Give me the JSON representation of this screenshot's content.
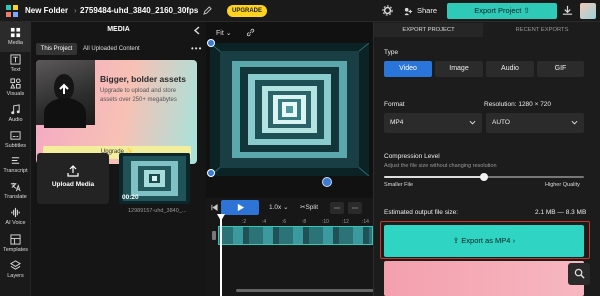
{
  "topbar": {
    "folder": "New Folder",
    "separator": "›",
    "filename": "2759484-uhd_3840_2160_30fps",
    "upgrade": "UPGRADE",
    "share": "Share",
    "export": "Export Project"
  },
  "nav": [
    {
      "label": "Media",
      "icon": "media-icon"
    },
    {
      "label": "Text",
      "icon": "text-icon"
    },
    {
      "label": "Visuals",
      "icon": "visuals-icon"
    },
    {
      "label": "Audio",
      "icon": "audio-icon"
    },
    {
      "label": "Subtitles",
      "icon": "subtitles-icon"
    },
    {
      "label": "Transcript",
      "icon": "transcript-icon"
    },
    {
      "label": "Translate",
      "icon": "translate-icon"
    },
    {
      "label": "AI Voice",
      "icon": "ai-voice-icon"
    },
    {
      "label": "Templates",
      "icon": "templates-icon"
    },
    {
      "label": "Layers",
      "icon": "layers-icon"
    }
  ],
  "media": {
    "title": "MEDIA",
    "tab_this": "This Project",
    "tab_all": "All Uploaded Content",
    "more": "•••",
    "promo_title": "Bigger, bolder assets",
    "promo_text": "Upgrade to upload and store assets over 250+ megabytes",
    "promo_button": "Upgrade ✨",
    "upload": "Upload Media",
    "thumb_duration": "00:20",
    "thumb_name": "12989157-uhd_3840_..."
  },
  "preview": {
    "fit": "Fit"
  },
  "timeline": {
    "speed": "1.0x",
    "split": "Split",
    "ticks": [
      ":2",
      ":4",
      ":6",
      ":8",
      ":10",
      ":12",
      ":14"
    ]
  },
  "export": {
    "tab_export": "EXPORT PROJECT",
    "tab_recent": "RECENT EXPORTS",
    "type_label": "Type",
    "types": [
      "Video",
      "Image",
      "Audio",
      "GIF"
    ],
    "active_type": "Video",
    "format_label": "Format",
    "resolution_label": "Resolution: 1280 × 720",
    "format_value": "MP4",
    "resolution_value": "AUTO",
    "compression_label": "Compression Level",
    "compression_sub": "Adjust the file size without changing resolution",
    "smaller": "Smaller File",
    "higher": "Higher Quality",
    "compression_level": 0.5,
    "size_label": "Estimated output file size:",
    "size_value": "2.1 MB — 8.3 MB",
    "export_mp4": "Export as MP4",
    "accent": "#2fd4c2",
    "blue": "#2a75d9"
  }
}
